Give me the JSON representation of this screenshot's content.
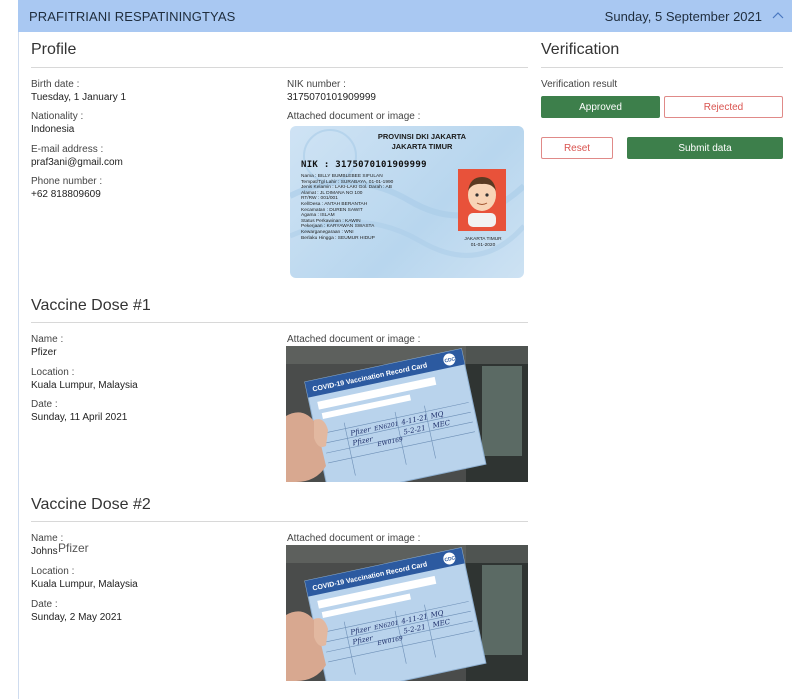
{
  "header": {
    "name": "PRAFITRIANI RESPATININGTYAS",
    "date": "Sunday, 5 September 2021",
    "collapse_icon": "chevron-up-icon"
  },
  "profile": {
    "title": "Profile",
    "birth_date_label": "Birth date :",
    "birth_date": "Tuesday, 1 January 1",
    "nationality_label": "Nationality :",
    "nationality": "Indonesia",
    "email_label": "E-mail address :",
    "email": "praf3ani@gmail.com",
    "phone_label": "Phone number :",
    "phone": "+62 818809609",
    "nik_label": "NIK number :",
    "nik": "3175070101909999",
    "attached_label": "Attached document or image :"
  },
  "id_card": {
    "province": "PROVINSI DKI JAKARTA",
    "city": "JAKARTA TIMUR",
    "nik_line": "NIK   : 3175070101909999",
    "rows": [
      "Nama            : BILLY BUMBLEBEE SIFULAN",
      "Tempat/Tgl Lahir : SURABAYA, 01-01-1990",
      "Jenis Kelamin   : LAKI-LAKI        Gol. Darah : AB",
      "Alamat          : JL DIMANA NO 100",
      "      RT/RW     : 001/001",
      "      Kel/Desa  : ANTAH BERANTAH",
      "      Kecamatan : DUREN SAWIT",
      "Agama           : ISLAM",
      "Status Perkawinan : KAWIN",
      "Pekerjaan       : KARYAWAN SWASTA",
      "Kewarganegaraan : WNI",
      "Berlaku Hingga  : SEUMUR HIDUP"
    ],
    "caption_city": "JAKARTA TIMUR",
    "caption_date": "01-01-2020"
  },
  "verification": {
    "title": "Verification",
    "result_label": "Verification result",
    "approved": "Approved",
    "rejected": "Rejected",
    "reset": "Reset",
    "submit": "Submit data"
  },
  "dose1": {
    "title": "Vaccine Dose #1",
    "name_label": "Name :",
    "name": "Pfizer",
    "location_label": "Location :",
    "location": "Kuala Lumpur, Malaysia",
    "date_label": "Date :",
    "date": "Sunday, 11 April 2021",
    "attached_label": "Attached document or image :"
  },
  "dose2": {
    "title": "Vaccine Dose #2",
    "name_label": "Name :",
    "name_under": "Johns",
    "name_overlay": "Pfizer",
    "location_label": "Location :",
    "location": "Kuala Lumpur, Malaysia",
    "date_label": "Date :",
    "date": "Sunday, 2 May 2021",
    "attached_label": "Attached document or image :"
  },
  "card_photo": {
    "title": "COVID-19 Vaccination Record Card",
    "logo": "CDC",
    "hw1": "Pfizer",
    "hw2": "Pfizer",
    "lot1": "EN6201",
    "lot2": "EW0169",
    "date1": "4-11-21",
    "date2": "5-2-21",
    "site1": "MQ",
    "site2": "MEC"
  },
  "colors": {
    "header_bg": "#a9c8f2",
    "approve_green": "#3d7f4b",
    "reject_red": "#d9534f"
  }
}
